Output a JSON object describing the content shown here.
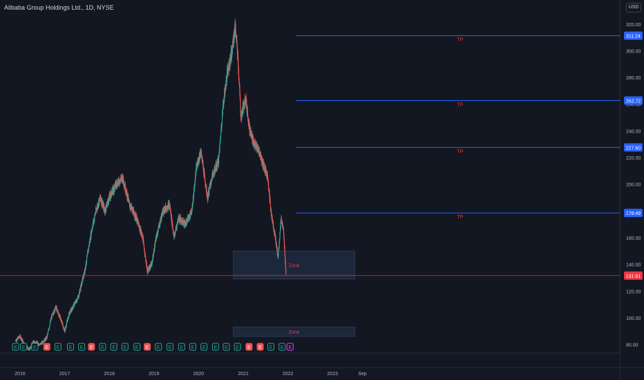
{
  "header": {
    "title": "Alibaba Group Holdings Ltd., 1D, NYSE",
    "currency": "USD"
  },
  "colors": {
    "background": "#131722",
    "up": "#26a69a",
    "down": "#ef5350",
    "tp_line": "#2962ff",
    "price_line": "#f23645",
    "zone_fill": "#1e2a40",
    "zone_border": "#2a3a55",
    "label_text": "#f23645",
    "axis_text": "#b2b5be"
  },
  "chart_data": {
    "type": "candlestick",
    "title": "Alibaba Group Holdings Ltd., 1D, NYSE",
    "ylim": [
      75,
      325
    ],
    "x_ticks": [
      "2016",
      "2017",
      "2018",
      "2019",
      "2020",
      "2021",
      "2022",
      "2023",
      "Sep"
    ],
    "y_ticks": [
      80,
      100,
      120,
      140,
      160,
      180,
      200,
      220,
      240,
      260,
      280,
      300,
      320
    ],
    "price_path": [
      {
        "t": 2015.9,
        "p": 83
      },
      {
        "t": 2016.0,
        "p": 86
      },
      {
        "t": 2016.1,
        "p": 80
      },
      {
        "t": 2016.2,
        "p": 76
      },
      {
        "t": 2016.3,
        "p": 82
      },
      {
        "t": 2016.45,
        "p": 80
      },
      {
        "t": 2016.6,
        "p": 85
      },
      {
        "t": 2016.7,
        "p": 100
      },
      {
        "t": 2016.8,
        "p": 108
      },
      {
        "t": 2016.9,
        "p": 100
      },
      {
        "t": 2017.0,
        "p": 90
      },
      {
        "t": 2017.1,
        "p": 103
      },
      {
        "t": 2017.3,
        "p": 115
      },
      {
        "t": 2017.45,
        "p": 135
      },
      {
        "t": 2017.6,
        "p": 165
      },
      {
        "t": 2017.7,
        "p": 180
      },
      {
        "t": 2017.8,
        "p": 190
      },
      {
        "t": 2017.9,
        "p": 180
      },
      {
        "t": 2018.0,
        "p": 190
      },
      {
        "t": 2018.15,
        "p": 200
      },
      {
        "t": 2018.3,
        "p": 205
      },
      {
        "t": 2018.45,
        "p": 185
      },
      {
        "t": 2018.6,
        "p": 175
      },
      {
        "t": 2018.75,
        "p": 160
      },
      {
        "t": 2018.85,
        "p": 135
      },
      {
        "t": 2018.95,
        "p": 140
      },
      {
        "t": 2019.05,
        "p": 160
      },
      {
        "t": 2019.2,
        "p": 180
      },
      {
        "t": 2019.35,
        "p": 185
      },
      {
        "t": 2019.45,
        "p": 160
      },
      {
        "t": 2019.55,
        "p": 175
      },
      {
        "t": 2019.7,
        "p": 170
      },
      {
        "t": 2019.85,
        "p": 180
      },
      {
        "t": 2019.95,
        "p": 212
      },
      {
        "t": 2020.05,
        "p": 225
      },
      {
        "t": 2020.2,
        "p": 190
      },
      {
        "t": 2020.3,
        "p": 205
      },
      {
        "t": 2020.45,
        "p": 218
      },
      {
        "t": 2020.55,
        "p": 260
      },
      {
        "t": 2020.65,
        "p": 285
      },
      {
        "t": 2020.75,
        "p": 300
      },
      {
        "t": 2020.82,
        "p": 318
      },
      {
        "t": 2020.88,
        "p": 295
      },
      {
        "t": 2020.95,
        "p": 250
      },
      {
        "t": 2021.05,
        "p": 265
      },
      {
        "t": 2021.15,
        "p": 240
      },
      {
        "t": 2021.25,
        "p": 230
      },
      {
        "t": 2021.35,
        "p": 225
      },
      {
        "t": 2021.45,
        "p": 215
      },
      {
        "t": 2021.55,
        "p": 205
      },
      {
        "t": 2021.62,
        "p": 180
      },
      {
        "t": 2021.72,
        "p": 160
      },
      {
        "t": 2021.78,
        "p": 145
      },
      {
        "t": 2021.85,
        "p": 175
      },
      {
        "t": 2021.9,
        "p": 165
      },
      {
        "t": 2021.93,
        "p": 150
      },
      {
        "t": 2021.96,
        "p": 131.61
      }
    ],
    "tp_levels": [
      {
        "label": "TP",
        "value": 311.24,
        "value_label": "311.24"
      },
      {
        "label": "TP",
        "value": 262.72,
        "value_label": "262.72"
      },
      {
        "label": "TP",
        "value": 227.6,
        "value_label": "227.60"
      },
      {
        "label": "TP",
        "value": 178.49,
        "value_label": "178.49"
      }
    ],
    "zones": [
      {
        "label": "Zone",
        "top": 150,
        "bottom": 129,
        "start": 2020.78,
        "end": 2023.5
      },
      {
        "label": "Zone",
        "top": 93,
        "bottom": 86,
        "start": 2020.78,
        "end": 2023.5
      }
    ],
    "last_price": {
      "value": 131.61,
      "label": "131.61"
    },
    "earnings_markers": [
      {
        "t": 2015.9,
        "type": "up"
      },
      {
        "t": 2016.08,
        "type": "up"
      },
      {
        "t": 2016.33,
        "type": "up"
      },
      {
        "t": 2016.6,
        "type": "down"
      },
      {
        "t": 2016.85,
        "type": "up"
      },
      {
        "t": 2017.13,
        "type": "up"
      },
      {
        "t": 2017.38,
        "type": "up"
      },
      {
        "t": 2017.6,
        "type": "down"
      },
      {
        "t": 2017.85,
        "type": "up"
      },
      {
        "t": 2018.1,
        "type": "up"
      },
      {
        "t": 2018.35,
        "type": "up"
      },
      {
        "t": 2018.62,
        "type": "up"
      },
      {
        "t": 2018.85,
        "type": "down"
      },
      {
        "t": 2019.1,
        "type": "up"
      },
      {
        "t": 2019.36,
        "type": "up"
      },
      {
        "t": 2019.62,
        "type": "up"
      },
      {
        "t": 2019.87,
        "type": "up"
      },
      {
        "t": 2020.12,
        "type": "up"
      },
      {
        "t": 2020.38,
        "type": "up"
      },
      {
        "t": 2020.62,
        "type": "up"
      },
      {
        "t": 2020.87,
        "type": "up"
      },
      {
        "t": 2021.13,
        "type": "down"
      },
      {
        "t": 2021.38,
        "type": "down"
      },
      {
        "t": 2021.62,
        "type": "up"
      },
      {
        "t": 2021.87,
        "type": "up"
      },
      {
        "t": 2022.05,
        "type": "pending"
      }
    ],
    "earnings_label": "E"
  }
}
